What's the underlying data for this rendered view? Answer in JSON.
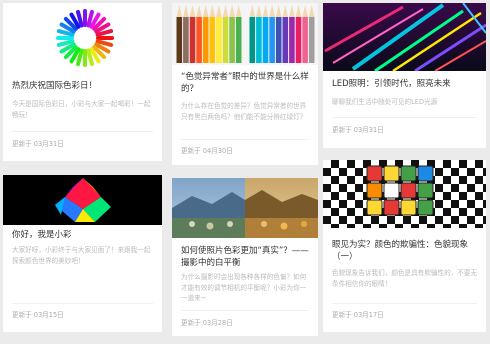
{
  "date_prefix": "更新于",
  "cards": [
    {
      "title": "热烈庆祝国际色彩日！",
      "excerpt": "今天是国际色彩日，小彩与大家一起喝彩！一起畅玩！",
      "date": "03月31日",
      "image_icon": "color-wheel-logo",
      "accent": "#e53935"
    },
    {
      "title": "“色觉异常者”眼中的世界是什么样的？",
      "excerpt": "为什么存在色觉的差异？色觉异常者的世界只有黑白两色吗？他们能不能分辨红绿灯？",
      "date": "04月30日",
      "image_icon": "colored-pencils"
    },
    {
      "title": "LED照明：引领时代，照亮未来",
      "excerpt": "聊聊我们生活中随处可见的LED光源",
      "date": "03月31日",
      "image_icon": "led-light-streaks"
    },
    {
      "title": "你好，我是小彩",
      "excerpt": "大家好呀，小彩终于与大家见面了！来跟我一起探索颜色世界的美妙吧！",
      "date": "03月15日",
      "image_icon": "rainbow-prism-logo"
    },
    {
      "title": "如何使照片色彩更加“真实”？——撮影中的白平衡",
      "excerpt": "为什么摄影时会出现各种各样的色偏？如何才能有效的调节相机的平衡呢？小彩为你一一道来~",
      "date": "03月28日",
      "image_icon": "landscape-photo"
    },
    {
      "title": "眼见为实？颜色的欺骗性：色貌现象（一）",
      "excerpt": "色貌现象告诉我们，颜色是具有欺骗性的，不要无条件相信你的眼睛！",
      "date": "03月17日",
      "image_icon": "rubik-cube-illusion"
    }
  ]
}
